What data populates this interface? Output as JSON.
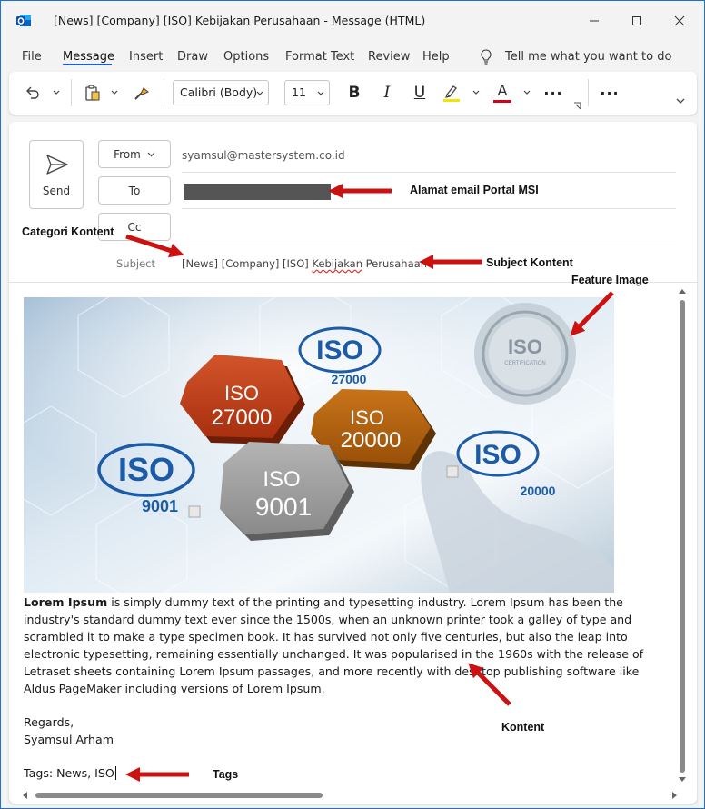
{
  "window": {
    "title": "[News] [Company] [ISO] Kebijakan Perusahaan  -  Message (HTML)"
  },
  "menu": {
    "items": [
      "File",
      "Message",
      "Insert",
      "Draw",
      "Options",
      "Format Text",
      "Review",
      "Help"
    ],
    "active": "Message",
    "tell_me": "Tell me what you want to do"
  },
  "ribbon": {
    "font_name": "Calibri (Body)",
    "font_size": "11",
    "bold": "B",
    "italic": "I",
    "underline": "U",
    "font_color_letter": "A",
    "more": "···",
    "highlight_color": "#f2e600",
    "font_color": "#d0021b"
  },
  "compose": {
    "send_label": "Send",
    "from_label": "From",
    "from_address": "syamsul@mastersystem.co.id",
    "to_label": "To",
    "cc_label": "Cc",
    "subject_label": "Subject",
    "subject_prefix": "[News] [Company] [ISO] ",
    "subject_squiggle": "Kebijakan",
    "subject_suffix": " Perusahaan"
  },
  "annotations": {
    "to": "Alamat email Portal MSI",
    "category": "Categori Kontent",
    "subject": "Subject Kontent",
    "feature": "Feature Image",
    "content": "Kontent",
    "tags": "Tags"
  },
  "image": {
    "hex_red_line1": "ISO",
    "hex_red_line2": "27000",
    "hex_orange_line1": "ISO",
    "hex_orange_line2": "20000",
    "hex_gray_line1": "ISO",
    "hex_gray_line2": "9001",
    "seal_text": "ISO",
    "seal_sub": "CERTIFICATION",
    "logo_left_word": "ISO",
    "logo_left_num": "9001",
    "logo_top_word": "ISO",
    "logo_top_num": "27000",
    "logo_right_word": "ISO",
    "logo_right_num": "20000",
    "logo_ring": "International Organization for Standardization"
  },
  "body": {
    "lead": "Lorem Ipsum",
    "text": " is simply dummy text of the printing and typesetting industry. Lorem Ipsum has been the industry's standard dummy text ever since the 1500s, when an unknown printer took a galley of type and scrambled it to make a type specimen book. It has survived not only five centuries, but also the leap into electronic typesetting, remaining essentially unchanged. It was popularised in the 1960s with the release of Letraset sheets containing Lorem Ipsum passages, and more recently with desktop publishing software like Aldus PageMaker including versions of Lorem Ipsum.",
    "regards": "Regards,",
    "signature": "Syamsul Arham",
    "tags": "Tags: News, ISO"
  },
  "colors": {
    "accent": "#1f5fbf",
    "arrow": "#cc1111"
  }
}
